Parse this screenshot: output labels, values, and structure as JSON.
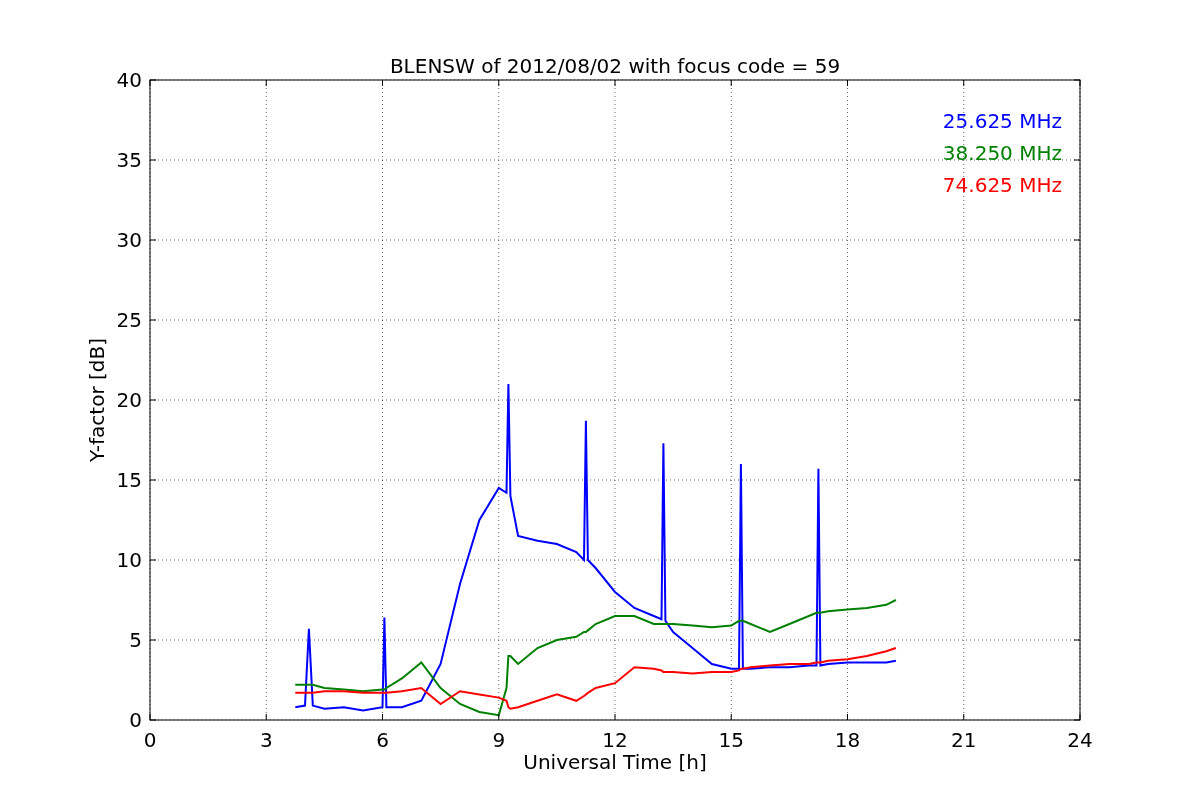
{
  "chart_data": {
    "type": "line",
    "title": "BLENSW of 2012/08/02 with focus code = 59",
    "xlabel": "Universal Time [h]",
    "ylabel": "Y-factor [dB]",
    "x": [
      3.75,
      4.0,
      4.1,
      4.2,
      4.5,
      5,
      5.5,
      6,
      6.05,
      6.1,
      6.5,
      7,
      7.5,
      8,
      8.5,
      9,
      9.2,
      9.25,
      9.3,
      9.5,
      10,
      10.5,
      11,
      11.2,
      11.25,
      11.3,
      11.5,
      12,
      12.5,
      13,
      13.2,
      13.25,
      13.3,
      13.5,
      14,
      14.5,
      15,
      15.2,
      15.25,
      15.3,
      15.5,
      16,
      16.5,
      17,
      17.2,
      17.25,
      17.3,
      17.5,
      18,
      18.5,
      19,
      19.25
    ],
    "series": [
      {
        "name": "25.625 MHz",
        "color": "#0000ff",
        "values": [
          0.8,
          0.9,
          5.7,
          0.9,
          0.7,
          0.8,
          0.6,
          0.8,
          6.4,
          0.8,
          0.8,
          1.2,
          3.5,
          8.5,
          12.5,
          14.5,
          14.2,
          21,
          14,
          11.5,
          11.2,
          11,
          10.5,
          10,
          18.7,
          10,
          9.5,
          8,
          7,
          6.5,
          6.3,
          17.3,
          6.2,
          5.5,
          4.5,
          3.5,
          3.2,
          3.2,
          16,
          3.2,
          3.2,
          3.3,
          3.3,
          3.4,
          3.4,
          15.7,
          3.4,
          3.5,
          3.6,
          3.6,
          3.6,
          3.7
        ]
      },
      {
        "name": "38.250 MHz",
        "color": "#008000",
        "values": [
          2.2,
          2.2,
          2.2,
          2.2,
          2.0,
          1.9,
          1.8,
          1.9,
          1.9,
          2.0,
          2.6,
          3.6,
          2.0,
          1.0,
          0.5,
          0.3,
          2,
          4,
          4,
          3.5,
          4.5,
          5,
          5.2,
          5.5,
          5.5,
          5.6,
          6,
          6.5,
          6.5,
          6,
          6,
          6,
          6,
          6,
          5.9,
          5.8,
          5.9,
          6.2,
          6.2,
          6.2,
          6,
          5.5,
          6,
          6.5,
          6.7,
          6.7,
          6.7,
          6.8,
          6.9,
          7,
          7.2,
          7.5
        ]
      },
      {
        "name": "74.625 MHz",
        "color": "#ff0000",
        "values": [
          1.7,
          1.7,
          1.7,
          1.7,
          1.8,
          1.8,
          1.7,
          1.7,
          1.7,
          1.7,
          1.8,
          2.0,
          1.0,
          1.8,
          1.6,
          1.4,
          1.2,
          0.8,
          0.7,
          0.8,
          1.2,
          1.6,
          1.2,
          1.5,
          1.6,
          1.7,
          2,
          2.3,
          3.3,
          3.2,
          3.1,
          3.0,
          3.0,
          3.0,
          2.9,
          3.0,
          3.0,
          3.1,
          3.2,
          3.2,
          3.3,
          3.4,
          3.5,
          3.5,
          3.6,
          3.6,
          3.6,
          3.7,
          3.8,
          4.0,
          4.3,
          4.5
        ]
      }
    ],
    "grid": true,
    "xlim": [
      0,
      24
    ],
    "ylim": [
      0,
      40
    ],
    "xticks": [
      0,
      3,
      6,
      9,
      12,
      15,
      18,
      21,
      24
    ],
    "yticks": [
      0,
      5,
      10,
      15,
      20,
      25,
      30,
      35,
      40
    ]
  }
}
